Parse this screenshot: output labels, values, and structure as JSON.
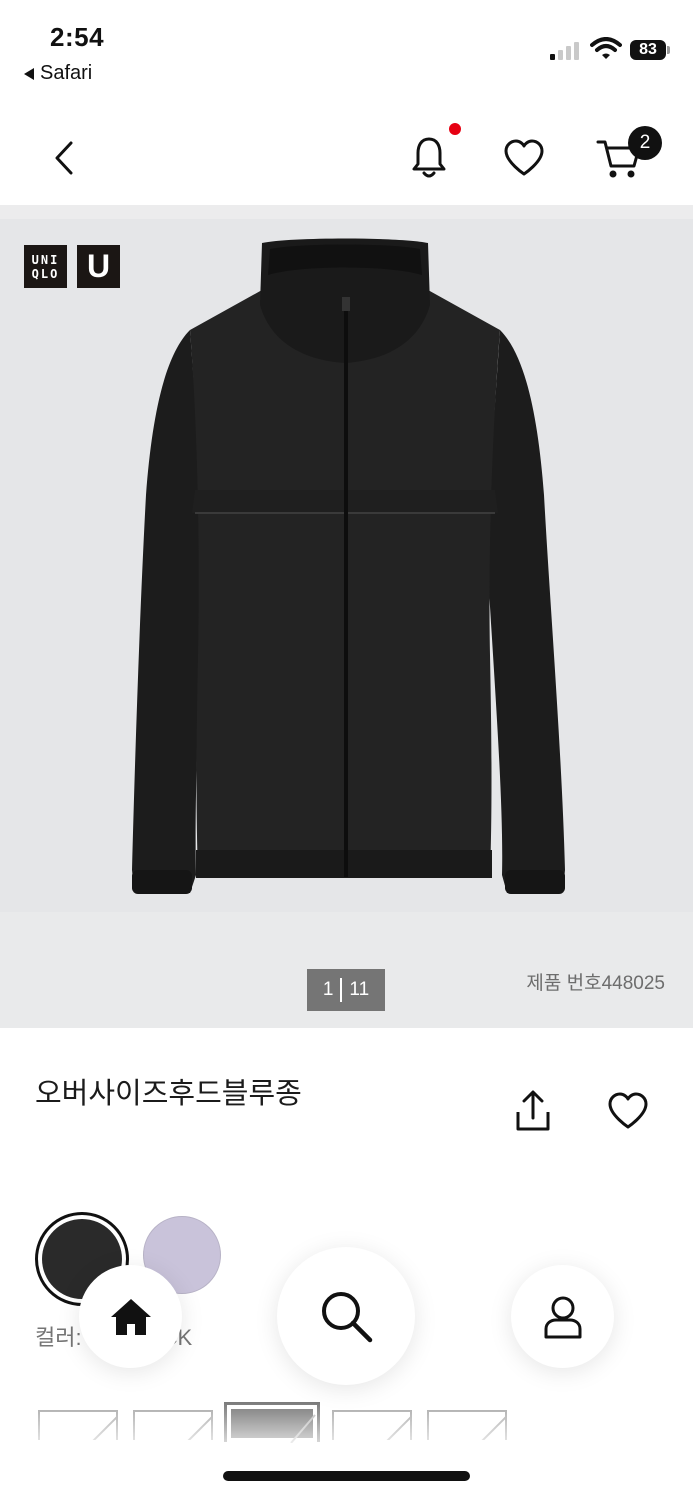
{
  "status_bar": {
    "time": "2:54",
    "back_app": "Safari",
    "battery": "83"
  },
  "header": {
    "back_icon": "chevron-left-icon",
    "notification_icon": "bell-icon",
    "wishlist_icon": "heart-icon",
    "cart_icon": "cart-icon",
    "cart_count": "2",
    "accent_color": "#e60012"
  },
  "hero": {
    "logo_uniqlo_line1": "UNI",
    "logo_uniqlo_line2": "QLO",
    "logo_u": "U",
    "pager_current": "1",
    "pager_total": "11",
    "product_number": "제품 번호448025"
  },
  "product": {
    "name": "오버사이즈후드블루종",
    "share_icon": "share-icon",
    "wishlist_icon": "heart-icon"
  },
  "colors": {
    "swatches": [
      {
        "name": "BLACK",
        "hex": "#2a2a2a",
        "selected": true
      },
      {
        "name": "",
        "hex": "#c9c3da",
        "selected": false
      }
    ],
    "label_left": "컬러:",
    "label_right": "CK"
  },
  "bottom_nav": {
    "home_icon": "home-icon",
    "search_icon": "search-icon",
    "account_icon": "user-icon"
  }
}
